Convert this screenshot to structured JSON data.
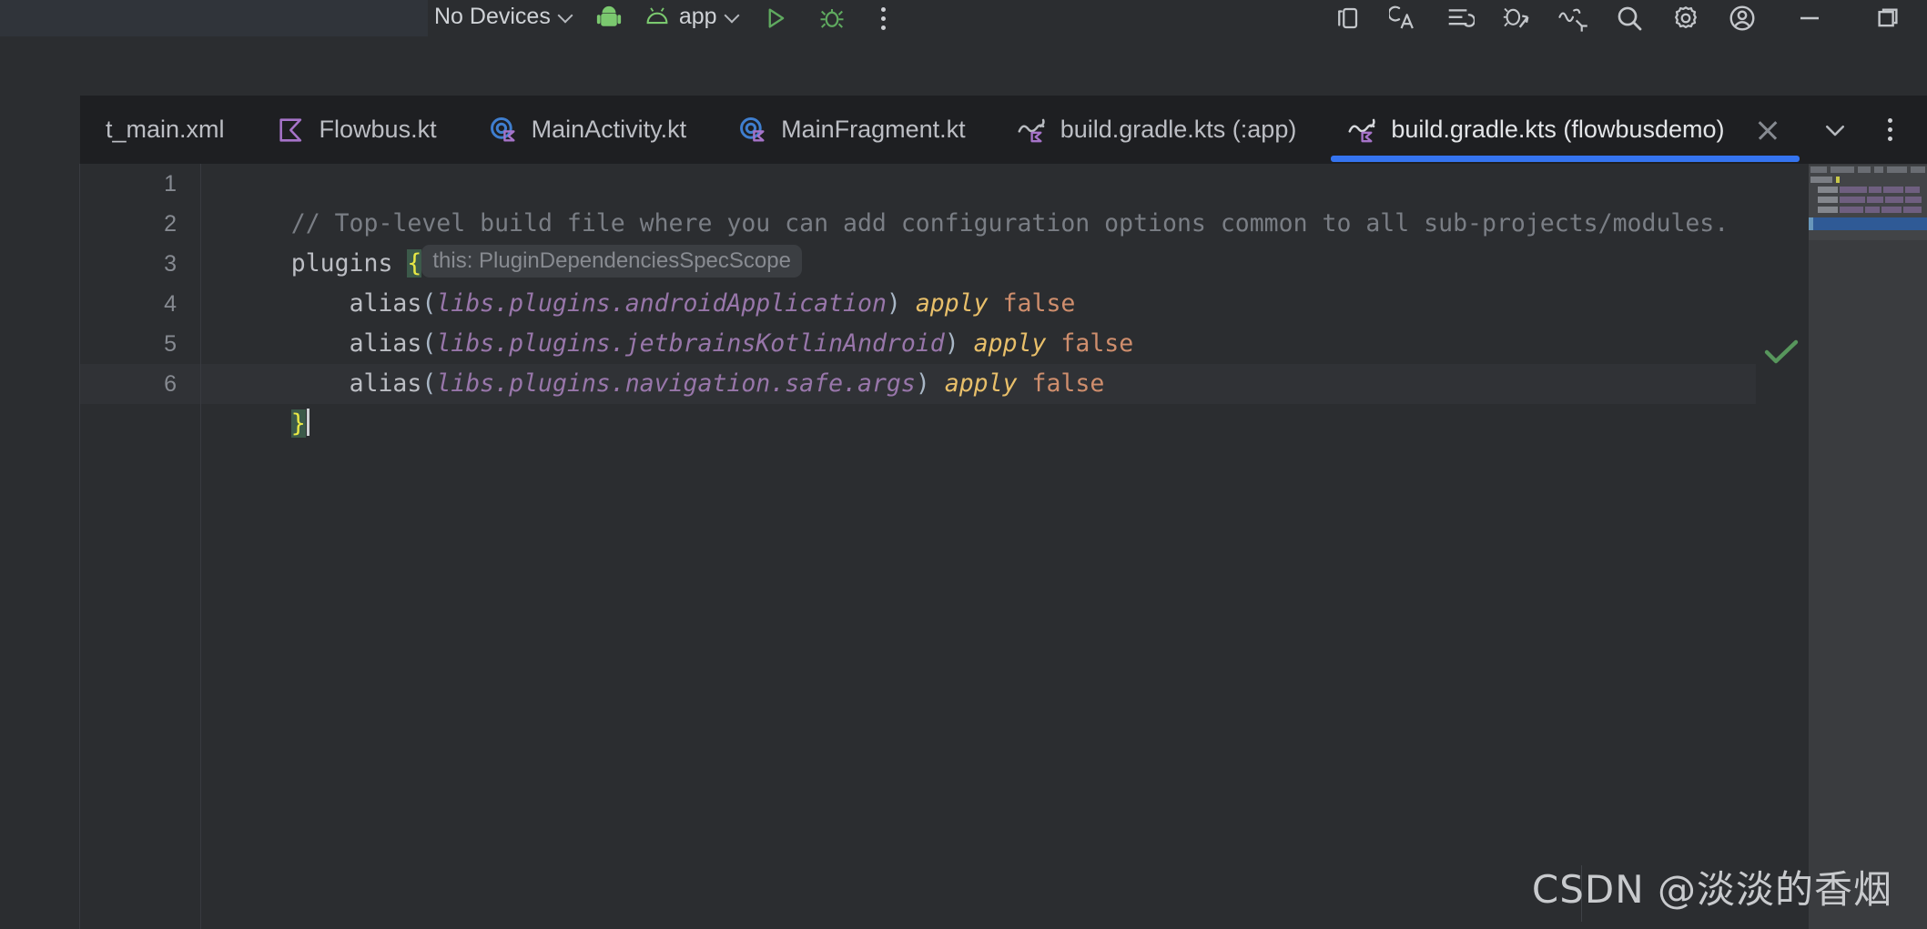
{
  "toolbar": {
    "device_selector": {
      "label": "No Devices",
      "icon": "chevron-down-icon"
    },
    "android_icon": "android-robot-icon",
    "run_config": {
      "label": "app",
      "icon": "android-head-icon",
      "chevron": "chevron-down-icon"
    },
    "run_button_icon": "run-play-icon",
    "debug_button_icon": "debug-bug-icon",
    "more_button_icon": "more-vertical-icon",
    "right_icons": [
      "device-manager-icon",
      "code-with-me-icon",
      "notifications-list-icon",
      "ai-assistant-icon",
      "updates-icon",
      "search-icon",
      "settings-gear-icon",
      "account-avatar-icon"
    ],
    "window_controls": [
      "minimize-icon",
      "maximize-restore-icon"
    ],
    "accent_green": "#6cc46c",
    "bg": "#2b2d30"
  },
  "tabs": {
    "items": [
      {
        "label": "t_main.xml",
        "icon": "xml-layout-icon",
        "active": false,
        "truncated": true
      },
      {
        "label": "Flowbus.kt",
        "icon": "kotlin-file-icon",
        "active": false
      },
      {
        "label": "MainActivity.kt",
        "icon": "kotlin-class-icon",
        "active": false
      },
      {
        "label": "MainFragment.kt",
        "icon": "kotlin-class-icon",
        "active": false
      },
      {
        "label": "build.gradle.kts (:app)",
        "icon": "gradle-kts-icon",
        "active": false
      },
      {
        "label": "build.gradle.kts (flowbusdemo)",
        "icon": "gradle-kts-icon",
        "active": true
      }
    ],
    "active_index": 5,
    "active_underline_color": "#3574f0",
    "close_icon": "close-icon",
    "list_icon": "chevron-down-icon",
    "options_icon": "more-vertical-icon"
  },
  "editor": {
    "file": "build.gradle.kts (flowbusdemo)",
    "current_line": 6,
    "lines": [
      {
        "no": "1",
        "type": "comment",
        "text": "// Top-level build file where you can add configuration options common to all sub-projects/modules."
      },
      {
        "no": "2",
        "type": "plugins_open",
        "name": "plugins",
        "brace": "{",
        "hint": "this: PluginDependenciesSpecScope"
      },
      {
        "no": "3",
        "type": "alias",
        "call": "alias",
        "open": "(",
        "ref": "libs.plugins.androidApplication",
        "close": ")",
        "apply": "apply",
        "value": "false"
      },
      {
        "no": "4",
        "type": "alias",
        "call": "alias",
        "open": "(",
        "ref": "libs.plugins.jetbrainsKotlinAndroid",
        "close": ")",
        "apply": "apply",
        "value": "false"
      },
      {
        "no": "5",
        "type": "alias",
        "call": "alias",
        "open": "(",
        "ref": "libs.plugins.navigation.safe.args",
        "close": ")",
        "apply": "apply",
        "value": "false"
      },
      {
        "no": "6",
        "type": "close_brace",
        "brace": "}"
      }
    ],
    "colors": {
      "background": "#2b2d30",
      "comment": "#7a7e85",
      "keyword": "#cf8e6d",
      "identifier": "#bcbec4",
      "property": "#9876aa",
      "infix_fn": "#e8bf6a",
      "brace_highlight": "#3c5a4a",
      "current_line": "#303236",
      "line_number": "#868a91",
      "inlay_hint_bg": "#3b3e42",
      "inlay_hint_fg": "#888b91"
    }
  },
  "inspections": {
    "status_icon": "checkmark-icon",
    "status_color": "#57965c",
    "status_text": "No problems found"
  },
  "minimap": {
    "selected_line": 6,
    "selection_color": "#2f5a96"
  },
  "watermark": {
    "text": "CSDN @淡淡的香烟"
  }
}
